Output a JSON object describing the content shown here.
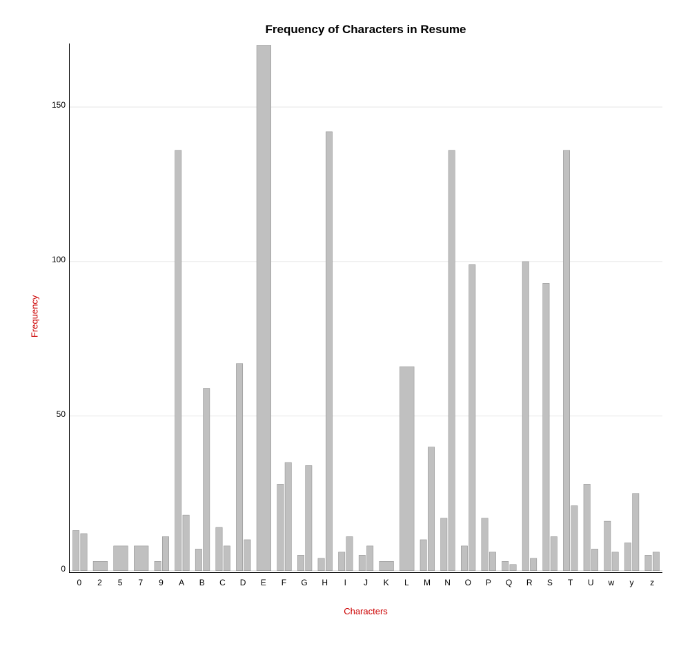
{
  "chart": {
    "title": "Frequency of Characters in Resume",
    "x_axis_label": "Characters",
    "y_axis_label": "Frequency",
    "y_ticks": [
      0,
      50,
      100,
      150
    ],
    "y_max": 170,
    "bars": [
      {
        "label": "0",
        "value": 13
      },
      {
        "label": "2",
        "value": 12
      },
      {
        "label": "5",
        "value": 3
      },
      {
        "label": "7",
        "value": 8
      },
      {
        "label": "9",
        "value": 8
      },
      {
        "label": "A",
        "value": 11
      },
      {
        "label": "A",
        "value": 136
      },
      {
        "label": "B",
        "value": 18
      },
      {
        "label": "B",
        "value": 7
      },
      {
        "label": "C",
        "value": 59
      },
      {
        "label": "C",
        "value": 14
      },
      {
        "label": "D",
        "value": 8
      },
      {
        "label": "D",
        "value": 67
      },
      {
        "label": "E",
        "value": 10
      },
      {
        "label": "E",
        "value": 170
      },
      {
        "label": "F",
        "value": 28
      },
      {
        "label": "F",
        "value": 35
      },
      {
        "label": "G",
        "value": 5
      },
      {
        "label": "G",
        "value": 34
      },
      {
        "label": "H",
        "value": 4
      },
      {
        "label": "H",
        "value": 142
      },
      {
        "label": "I",
        "value": 6
      },
      {
        "label": "I",
        "value": 11
      },
      {
        "label": "J",
        "value": 5
      },
      {
        "label": "J",
        "value": 8
      },
      {
        "label": "K",
        "value": 3
      },
      {
        "label": "L",
        "value": 66
      },
      {
        "label": "M",
        "value": 10
      },
      {
        "label": "M",
        "value": 40
      },
      {
        "label": "N",
        "value": 17
      },
      {
        "label": "N",
        "value": 136
      },
      {
        "label": "O",
        "value": 8
      },
      {
        "label": "O",
        "value": 99
      },
      {
        "label": "P",
        "value": 17
      },
      {
        "label": "P",
        "value": 6
      },
      {
        "label": "Q",
        "value": 3
      },
      {
        "label": "Q",
        "value": 2
      },
      {
        "label": "R",
        "value": 100
      },
      {
        "label": "R",
        "value": 4
      },
      {
        "label": "S",
        "value": 93
      },
      {
        "label": "S",
        "value": 11
      },
      {
        "label": "T",
        "value": 136
      },
      {
        "label": "T",
        "value": 21
      },
      {
        "label": "U",
        "value": 28
      },
      {
        "label": "U",
        "value": 7
      },
      {
        "label": "w",
        "value": 16
      },
      {
        "label": "w",
        "value": 6
      },
      {
        "label": "y",
        "value": 9
      },
      {
        "label": "y",
        "value": 25
      },
      {
        "label": "z",
        "value": 5
      },
      {
        "label": "z",
        "value": 6
      }
    ],
    "x_labels": [
      "0",
      "2",
      "5",
      "7",
      "9",
      "A",
      "B",
      "C",
      "D",
      "E",
      "F",
      "G",
      "H",
      "I",
      "J",
      "K",
      "L",
      "M",
      "N",
      "O",
      "P",
      "Q",
      "R",
      "S",
      "T",
      "U",
      "w",
      "y",
      "z"
    ]
  }
}
